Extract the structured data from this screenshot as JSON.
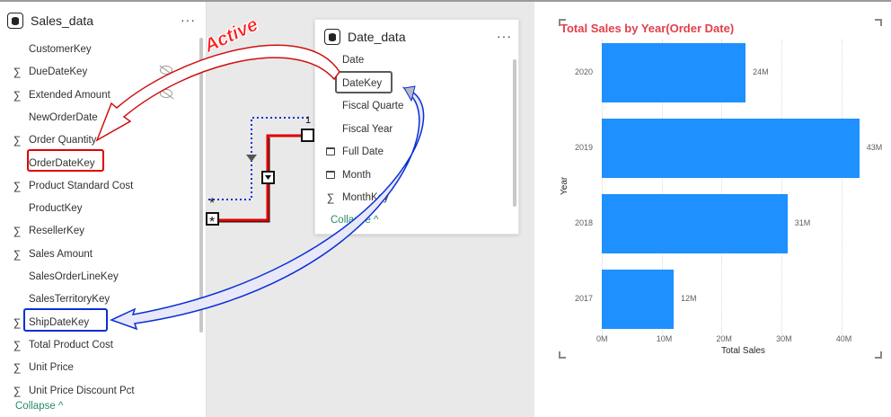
{
  "sales_table": {
    "title": "Sales_data",
    "more": "···",
    "fields": [
      {
        "label": "CustomerKey",
        "sigma": false
      },
      {
        "label": "DueDateKey",
        "sigma": true
      },
      {
        "label": "Extended Amount",
        "sigma": true
      },
      {
        "label": "NewOrderDate",
        "sigma": false
      },
      {
        "label": "Order Quantity",
        "sigma": true
      },
      {
        "label": "OrderDateKey",
        "sigma": false
      },
      {
        "label": "Product Standard Cost",
        "sigma": true
      },
      {
        "label": "ProductKey",
        "sigma": false
      },
      {
        "label": "ResellerKey",
        "sigma": true
      },
      {
        "label": "Sales Amount",
        "sigma": true
      },
      {
        "label": "SalesOrderLineKey",
        "sigma": false
      },
      {
        "label": "SalesTerritoryKey",
        "sigma": false
      },
      {
        "label": "ShipDateKey",
        "sigma": true
      },
      {
        "label": "Total Product Cost",
        "sigma": true
      },
      {
        "label": "Unit Price",
        "sigma": true
      },
      {
        "label": "Unit Price Discount Pct",
        "sigma": true
      }
    ],
    "collapse": "Collapse ^"
  },
  "date_table": {
    "title": "Date_data",
    "more": "···",
    "fields": [
      {
        "label": "Date",
        "icon": ""
      },
      {
        "label": "DateKey",
        "icon": ""
      },
      {
        "label": "Fiscal Quarte",
        "icon": ""
      },
      {
        "label": "Fiscal Year",
        "icon": ""
      },
      {
        "label": "Full Date",
        "icon": "calendar"
      },
      {
        "label": "Month",
        "icon": "calendar"
      },
      {
        "label": "MonthKey",
        "icon": "sigma"
      }
    ],
    "collapse": "Collapse ^"
  },
  "relationship": {
    "one_label": "1",
    "many_label": "*",
    "active_label": "Active"
  },
  "sigma_symbol": "∑",
  "colors": {
    "bar": "#1e90ff",
    "chart_title": "#e0404a",
    "active_relation": "#e00000",
    "inactive_relation": "#0a2fd6"
  },
  "chart_data": {
    "type": "bar",
    "orientation": "horizontal",
    "title": "Total Sales by Year(Order Date)",
    "xlabel": "Total Sales",
    "ylabel": "Year",
    "categories": [
      "2020",
      "2019",
      "2018",
      "2017"
    ],
    "values": [
      24,
      43,
      31,
      12
    ],
    "data_labels": [
      "24M",
      "43M",
      "31M",
      "12M"
    ],
    "x_ticks": [
      "0M",
      "10M",
      "20M",
      "30M",
      "40M"
    ],
    "xlim": [
      0,
      45
    ],
    "grid": true
  }
}
